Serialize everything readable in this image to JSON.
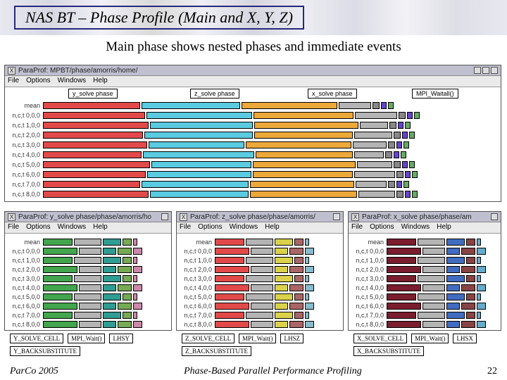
{
  "slide": {
    "title": "NAS BT – Phase Profile (Main and X, Y, Z)",
    "subtitle": "Main phase shows nested phases and immediate events",
    "footer_left": "ParCo 2005",
    "footer_mid": "Phase-Based Parallel Performance Profiling",
    "page": "22"
  },
  "menus": {
    "file": "File",
    "options": "Options",
    "windows": "Windows",
    "help": "Help"
  },
  "main_window": {
    "title": "ParaProf: MPBT/phase/amorris/home/",
    "header_labels": [
      "y_solve phase",
      "z_solve phase",
      "x_solve phase",
      "MPI_Waitall()"
    ],
    "rows": [
      "mean",
      "n,c,t 0,0,0",
      "n,c,t 1,0,0",
      "n,c,t 2,0,0",
      "n,c,t 3,0,0",
      "n,c,t 4,0,0",
      "n,c,t 5,0,0",
      "n,c,t 6,0,0",
      "n,c,t 7,0,0",
      "n,c,t 8,0,0"
    ]
  },
  "y_window": {
    "title": "ParaProf: y_solve phase/phase/amorris/ho",
    "rows": [
      "mean",
      "n,c,t 0,0,0",
      "n,c,t 1,0,0",
      "n,c,t 2,0,0",
      "n,c,t 3,0,0",
      "n,c,t 4,0,0",
      "n,c,t 5,0,0",
      "n,c,t 6,0,0",
      "n,c,t 7,0,0",
      "n,c,t 8,0,0"
    ],
    "legend": [
      "Y_SOLVE_CELL",
      "MPI_Wait()",
      "LHSY"
    ],
    "legend2": "Y_BACKSUBSTITUTE"
  },
  "z_window": {
    "title": "ParaProf: z_solve phase/phase/amorris/",
    "rows": [
      "mean",
      "n,c,t 0,0,0",
      "n,c,t 1,0,0",
      "n,c,t 2,0,0",
      "n,c,t 3,0,0",
      "n,c,t 4,0,0",
      "n,c,t 5,0,0",
      "n,c,t 6,0,0",
      "n,c,t 7,0,0",
      "n,c,t 8,0,0"
    ],
    "legend": [
      "Z_SOLVE_CELL",
      "MPI_Wait()",
      "LHSZ"
    ],
    "legend2": "Z_BACKSUBSTITUTE"
  },
  "x_window": {
    "title": "ParaProf: x_solve phase/phase/am",
    "rows": [
      "mean",
      "n,c,t 0,0,0",
      "n,c,t 1,0,0",
      "n,c,t 2,0,0",
      "n,c,t 3,0,0",
      "n,c,t 4,0,0",
      "n,c,t 5,0,0",
      "n,c,t 6,0,0",
      "n,c,t 7,0,0",
      "n,c,t 8,0,0"
    ],
    "legend": [
      "X_SOLVE_CELL",
      "MPI_Wait()",
      "LHSX"
    ],
    "legend2": "X_BACKSUBSTITUTE"
  },
  "colors": {
    "red": "#e24a4a",
    "cyan": "#5acbe0",
    "orange": "#eda83a",
    "grey": "#b4b4b4",
    "green": "#43a54d",
    "teal": "#2f9d92",
    "darkred": "#7a1d2e",
    "yellow": "#d9d24a",
    "blue": "#426cc0"
  }
}
